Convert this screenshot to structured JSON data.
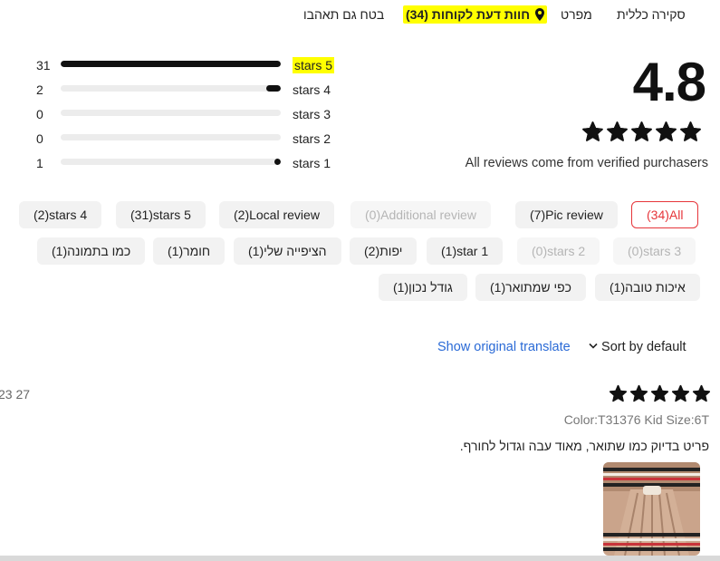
{
  "tabs": [
    {
      "label": "סקירה כללית"
    },
    {
      "label": "מפרט"
    },
    {
      "label": "חוות דעת לקוחות (34)"
    },
    {
      "label": "בטח גם תאהבו"
    }
  ],
  "rating": {
    "score": "4.8",
    "stars_value": 4.8,
    "verified_text": "All reviews come from verified purchasers",
    "rows": [
      {
        "label": "stars 5",
        "count": "31",
        "fraction": 1.0
      },
      {
        "label": "stars 4",
        "count": "2",
        "fraction": 0.065
      },
      {
        "label": "stars 3",
        "count": "0",
        "fraction": 0
      },
      {
        "label": "stars 2",
        "count": "0",
        "fraction": 0
      },
      {
        "label": "stars 1",
        "count": "1",
        "fraction": 0.032
      }
    ]
  },
  "filters": {
    "row1": [
      {
        "label": "(34)All",
        "state": "active"
      },
      {
        "label": "(7)Pic review",
        "state": "normal"
      },
      {
        "label": "(0)Additional review",
        "state": "disabled"
      },
      {
        "label": "(2)Local review",
        "state": "normal"
      },
      {
        "label": "(31)stars 5",
        "state": "normal"
      },
      {
        "label": "(2)stars 4",
        "state": "normal"
      }
    ],
    "row2": [
      {
        "label": "(0)stars 3",
        "state": "disabled"
      },
      {
        "label": "(0)stars 2",
        "state": "disabled"
      },
      {
        "label": "(1)star 1",
        "state": "normal"
      },
      {
        "label": "יפות(2)",
        "state": "normal"
      },
      {
        "label": "הציפייה שלי(1)",
        "state": "normal"
      },
      {
        "label": "חומר(1)",
        "state": "normal"
      },
      {
        "label": "כמו בתמונה(1)",
        "state": "normal"
      }
    ],
    "row3": [
      {
        "label": "איכות טובה(1)",
        "state": "normal"
      },
      {
        "label": "כפי שמתואר(1)",
        "state": "normal"
      },
      {
        "label": "גודל נכון(1)",
        "state": "normal"
      }
    ]
  },
  "toolbar": {
    "translate_label": "Show original translate",
    "sort_label": "Sort by default"
  },
  "review": {
    "stars": 5,
    "date": "23 27",
    "variant": "Color:T31376 Kid Size:6T",
    "text": "פריט בדיוק כמו שתואר, מאוד עבה וגדול לחורף."
  },
  "colors": {
    "highlight": "#ffff00",
    "active_chip": "#e6353a",
    "link": "#2a6ad6",
    "bar_fill": "#111111"
  }
}
